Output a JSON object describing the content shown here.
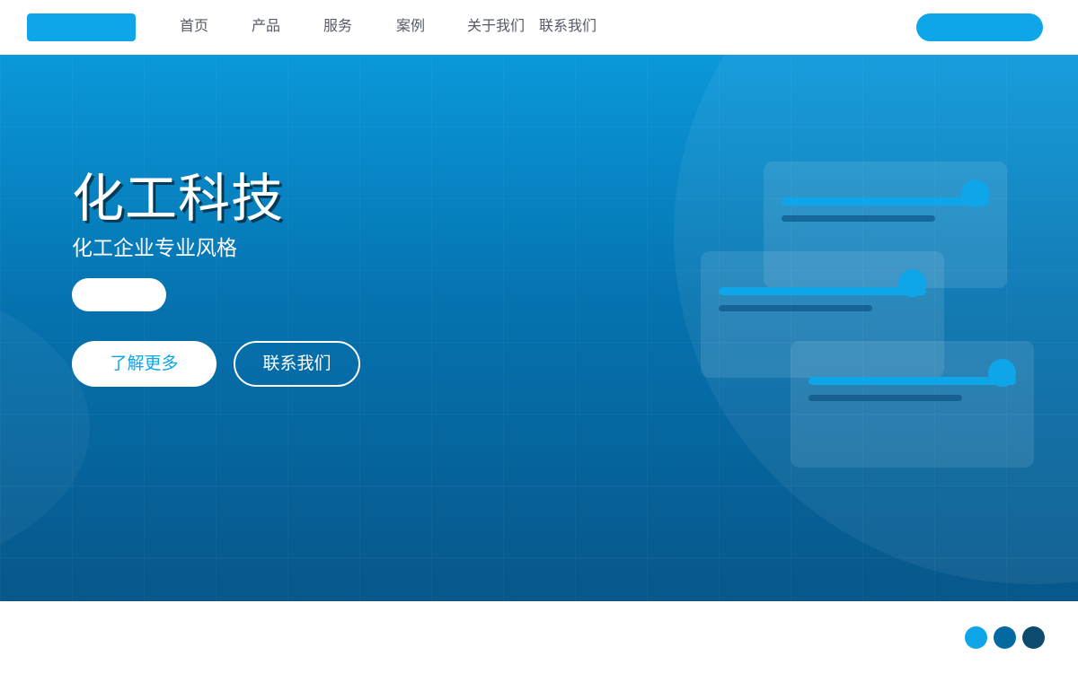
{
  "nav": {
    "items": [
      {
        "label": "首页"
      },
      {
        "label": "产品"
      },
      {
        "label": "服务"
      },
      {
        "label": "案例"
      },
      {
        "label": "关于我们"
      },
      {
        "label": "联系我们"
      }
    ]
  },
  "hero": {
    "title": "化工科技",
    "subtitle": "化工企业专业风格",
    "primary_button_label": "了解更多",
    "secondary_button_label": "联系我们"
  },
  "colors": {
    "accent": "#0ea5e9",
    "hero_top": "#0a98da",
    "hero_bottom": "#07578a",
    "palette": [
      "#0ea5e9",
      "#0369a1",
      "#0c4a6e"
    ]
  }
}
